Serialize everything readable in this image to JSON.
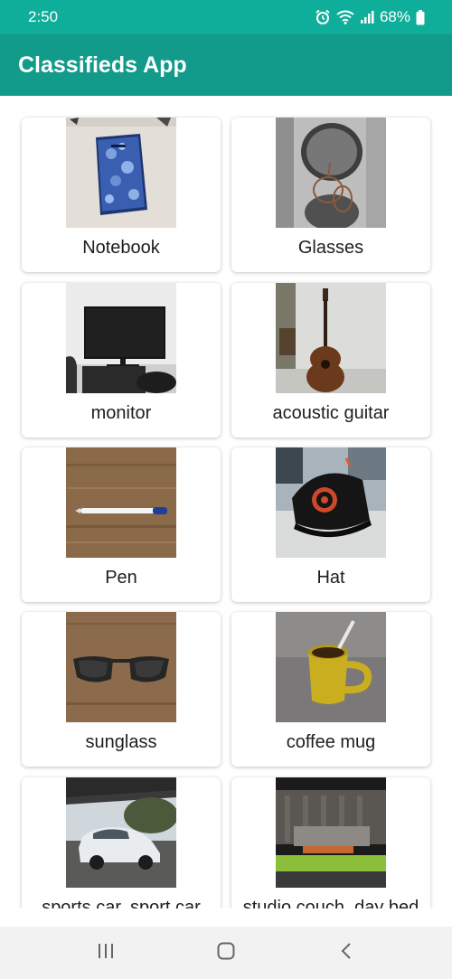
{
  "status_bar": {
    "time": "2:50",
    "battery": "68%",
    "icons": [
      "alarm-icon",
      "wifi-icon",
      "signal-icon",
      "battery-icon"
    ]
  },
  "app_bar": {
    "title": "Classifieds App"
  },
  "listings": [
    {
      "label": "Notebook",
      "image": "notebook-photo"
    },
    {
      "label": "Glasses",
      "image": "glasses-photo"
    },
    {
      "label": "monitor",
      "image": "monitor-photo"
    },
    {
      "label": "acoustic guitar",
      "image": "guitar-photo"
    },
    {
      "label": "Pen",
      "image": "pen-photo"
    },
    {
      "label": "Hat",
      "image": "hat-photo"
    },
    {
      "label": "sunglass",
      "image": "sunglass-photo"
    },
    {
      "label": "coffee mug",
      "image": "coffee-mug-photo"
    },
    {
      "label": "sports car, sport car",
      "image": "car-photo"
    },
    {
      "label": "studio couch, day bed",
      "image": "couch-photo"
    }
  ],
  "nav_bar": {
    "icons": [
      "recent-apps-icon",
      "home-icon",
      "back-icon"
    ]
  },
  "colors": {
    "status_bar": "#0fae9a",
    "app_bar": "#129a8b",
    "nav_bar": "#f2f2f2"
  }
}
